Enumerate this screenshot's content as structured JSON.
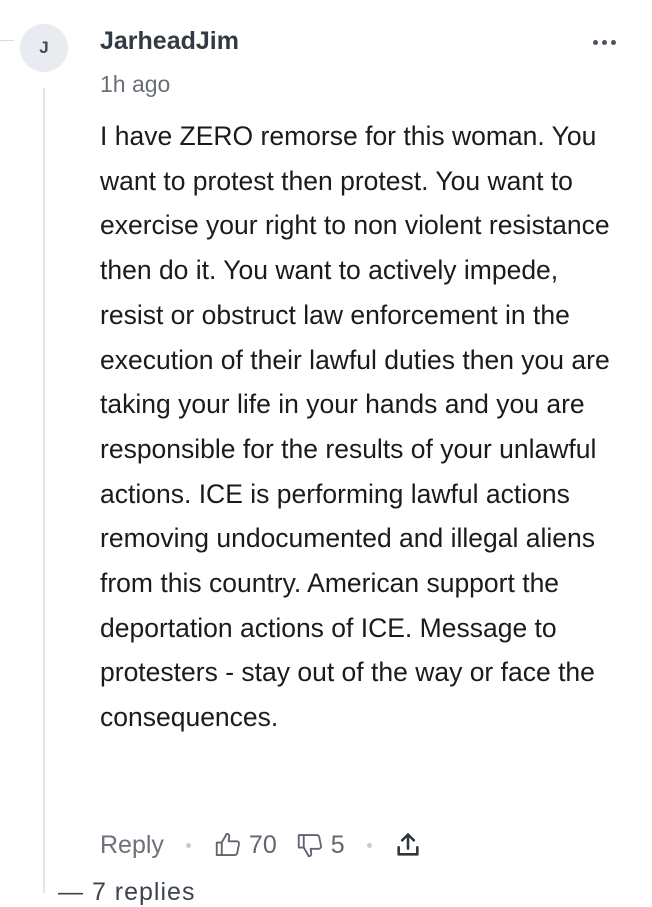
{
  "comment": {
    "avatar_initial": "J",
    "username": "JarheadJim",
    "timestamp": "1h ago",
    "body": "I have ZERO remorse for this woman. You want to protest then protest. You want to exercise your right to non violent resistance then do it. You want to actively impede, resist or obstruct law enforcement in the execution of their lawful duties then you are taking your life in your hands and you are responsible for the results of your unlawful actions. ICE is performing lawful actions removing undocumented and illegal aliens from this country. American support the deportation actions of ICE. Message to protesters - stay out of the way or face the consequences.",
    "actions": {
      "reply_label": "Reply",
      "upvotes": "70",
      "downvotes": "5"
    }
  },
  "icons": {
    "more": "more-horizontal-icon",
    "upvote": "thumbs-up-icon",
    "downvote": "thumbs-down-icon",
    "share": "share-icon"
  },
  "cut_text": "— 7 replies"
}
